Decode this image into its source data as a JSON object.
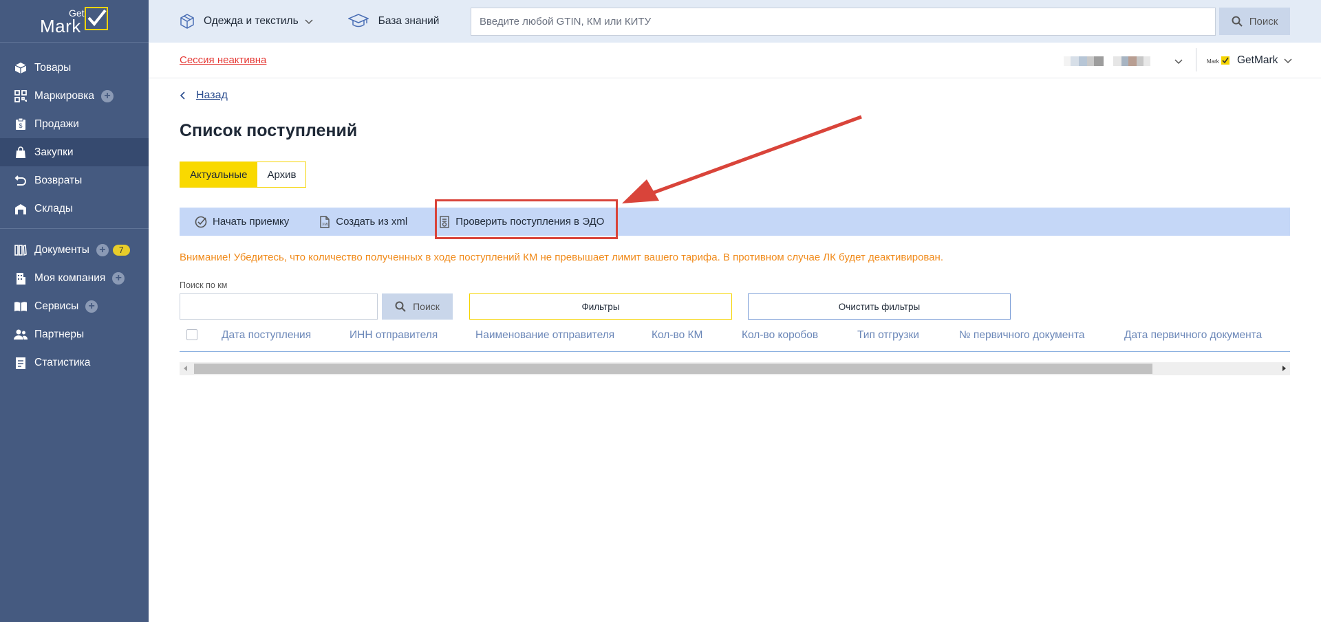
{
  "brand": {
    "get": "Get",
    "mark": "Mark",
    "accent": "#f5d400"
  },
  "sidebar": {
    "items": [
      {
        "label": "Товары",
        "icon": "box-icon"
      },
      {
        "label": "Маркировка",
        "icon": "qr-icon",
        "plus": true
      },
      {
        "label": "Продажи",
        "icon": "receipt-icon"
      },
      {
        "label": "Закупки",
        "icon": "shopping-bag-icon",
        "active": true
      },
      {
        "label": "Возвраты",
        "icon": "return-icon"
      },
      {
        "label": "Склады",
        "icon": "warehouse-icon"
      }
    ],
    "items2": [
      {
        "label": "Документы",
        "icon": "documents-icon",
        "plus": true,
        "badge": "7"
      },
      {
        "label": "Моя компания",
        "icon": "building-icon",
        "plus": true
      },
      {
        "label": "Сервисы",
        "icon": "book-icon",
        "plus": true
      },
      {
        "label": "Партнеры",
        "icon": "people-icon"
      },
      {
        "label": "Статистика",
        "icon": "stats-icon"
      }
    ]
  },
  "topbar": {
    "category": "Одежда и текстиль",
    "knowledge_base": "База знаний",
    "search_placeholder": "Введите любой GTIN, КМ или КИТУ",
    "search_button": "Поиск"
  },
  "session": {
    "status": "Сессия неактивна",
    "organization": "GetMark"
  },
  "main": {
    "back": "Назад",
    "title": "Список поступлений",
    "tabs": [
      "Актуальные",
      "Архив"
    ],
    "actions": [
      "Начать приемку",
      "Создать из xml",
      "Проверить поступления в ЭДО"
    ],
    "warning": "Внимание! Убедитесь, что количество полученных в ходе поступлений КМ не превышает лимит вашего тарифа. В противном случае ЛК будет деактивирован.",
    "km_search_label": "Поиск по км",
    "km_search_value": "",
    "km_search_button": "Поиск",
    "filters_button": "Фильтры",
    "clear_filters_button": "Очистить фильтры",
    "columns": [
      "Дата поступления",
      "ИНН отправителя",
      "Наименование отправителя",
      "Кол-во КМ",
      "Кол-во коробов",
      "Тип отгрузки",
      "№ первичного документа",
      "Дата первичного документа"
    ]
  }
}
